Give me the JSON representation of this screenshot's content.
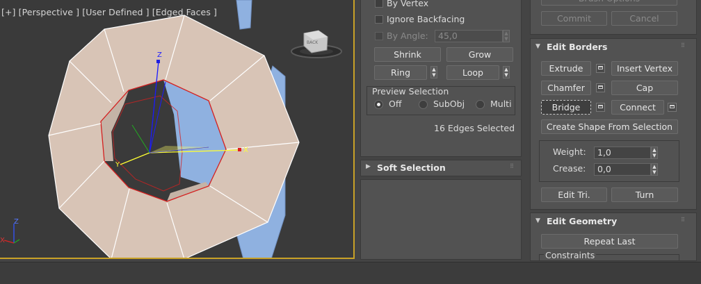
{
  "viewport": {
    "label_plus": "[+]",
    "label_view": "[Perspective ]",
    "label_shading": "[User Defined ]",
    "label_mode": "[Edged Faces ]",
    "viewcube_text": "BACK",
    "axis_x": "X",
    "axis_y": "Y",
    "axis_z": "Z",
    "mini_axis_z": "Z",
    "mini_axis_x": "X"
  },
  "selection_panel": {
    "by_vertex": "By Vertex",
    "ignore_backfacing": "Ignore Backfacing",
    "by_angle": "By Angle:",
    "angle_value": "45,0",
    "shrink": "Shrink",
    "grow": "Grow",
    "ring": "Ring",
    "loop": "Loop",
    "preview_title": "Preview Selection",
    "preview_off": "Off",
    "preview_subobj": "SubObj",
    "preview_multi": "Multi",
    "status": "16 Edges Selected",
    "soft_selection": "Soft Selection"
  },
  "edit_borders": {
    "top_partial": "Brush Options",
    "commit": "Commit",
    "cancel": "Cancel",
    "title": "Edit Borders",
    "extrude": "Extrude",
    "insert_vertex": "Insert Vertex",
    "chamfer": "Chamfer",
    "cap": "Cap",
    "bridge": "Bridge",
    "connect": "Connect",
    "create_shape": "Create Shape From Selection",
    "weight_label": "Weight:",
    "weight_value": "1,0",
    "crease_label": "Crease:",
    "crease_value": "0,0",
    "edit_tri": "Edit Tri.",
    "turn": "Turn"
  },
  "edit_geometry": {
    "title": "Edit Geometry",
    "repeat_last": "Repeat Last",
    "constraints": "Constraints"
  },
  "colors": {
    "face": "#d8c4b6",
    "selected_edge": "#d42020",
    "background_obj": "#8fb1e0",
    "active_border": "#c9a227"
  }
}
